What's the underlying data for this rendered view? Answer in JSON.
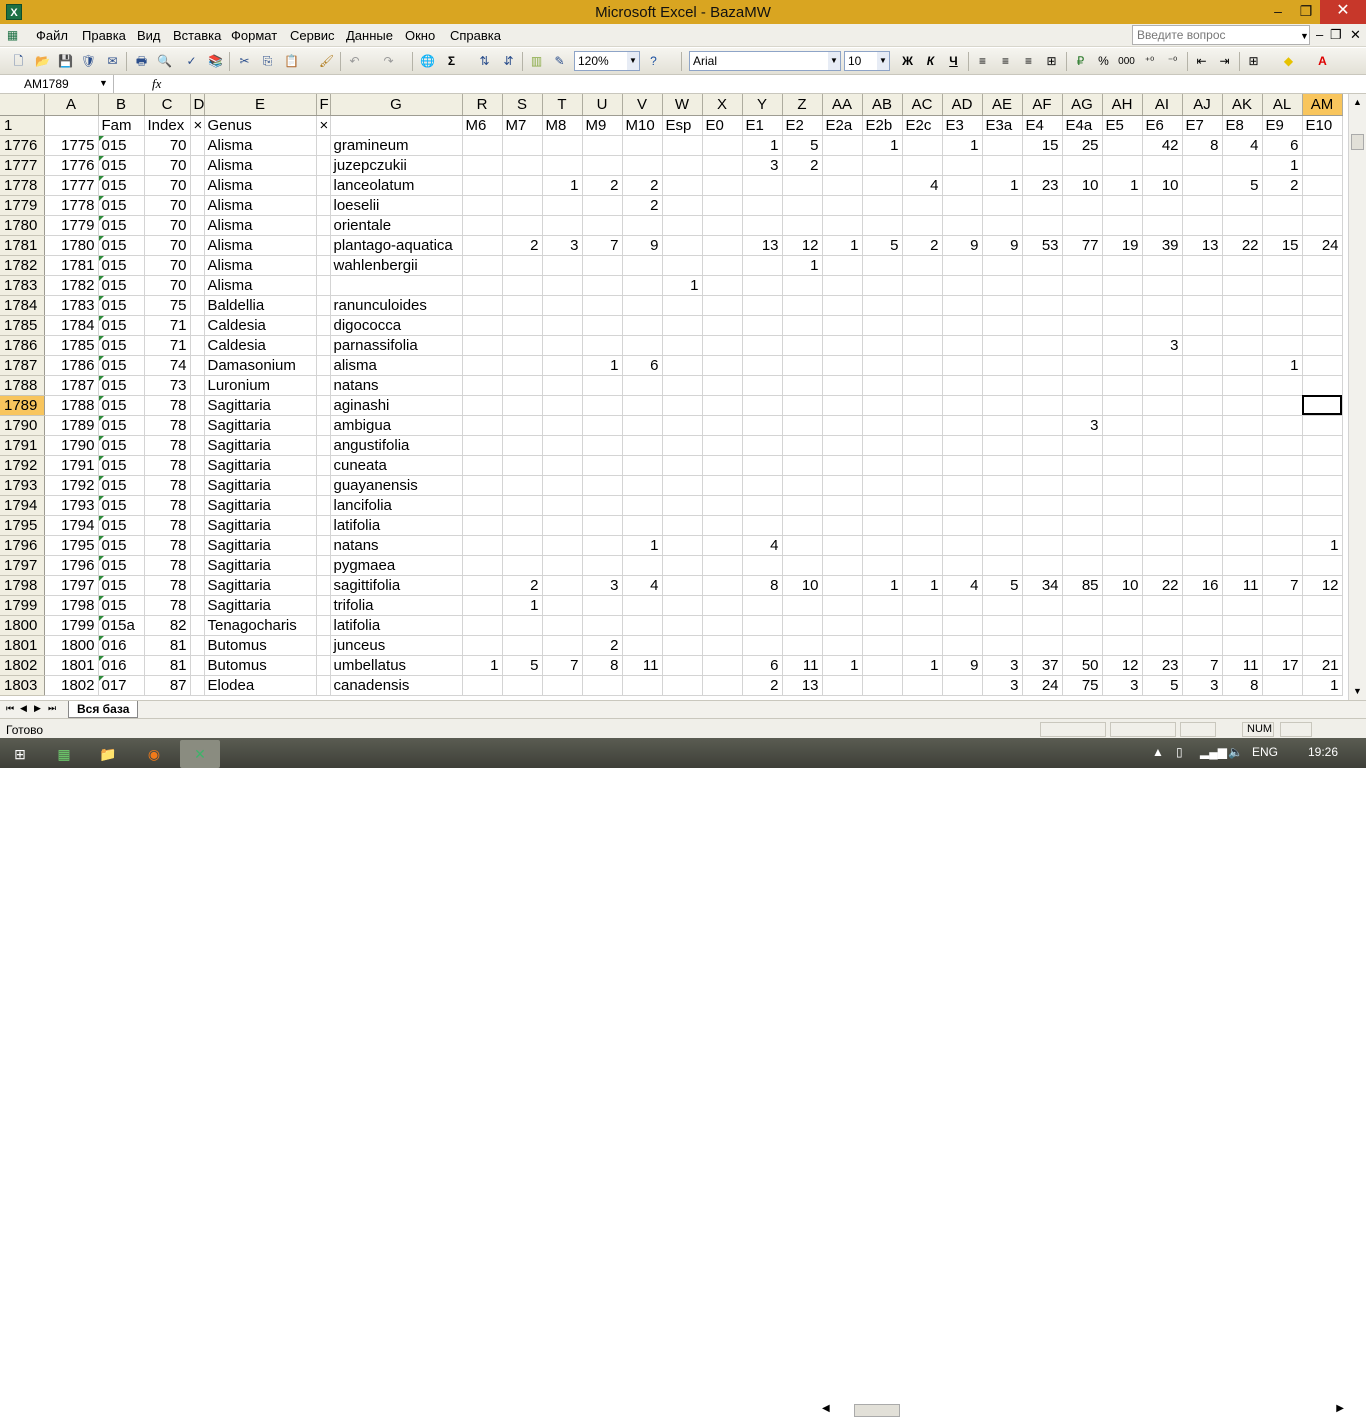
{
  "window": {
    "title": "Microsoft Excel - BazaMW",
    "app_icon": "X"
  },
  "menu": [
    "Файл",
    "Правка",
    "Вид",
    "Вставка",
    "Формат",
    "Сервис",
    "Данные",
    "Окно",
    "Справка"
  ],
  "help_box": {
    "placeholder": "Введите вопрос"
  },
  "toolbar": {
    "zoom": "120%",
    "font": "Arial",
    "size": "10",
    "bold": "Ж",
    "italic": "К",
    "underline": "Ч",
    "percent": "%",
    "thousands": "000",
    "sigma": "Σ"
  },
  "formula_bar": {
    "name_box": "AM1789",
    "fx": "fx",
    "value": ""
  },
  "columns": [
    "A",
    "B",
    "C",
    "D",
    "E",
    "F",
    "G",
    "R",
    "S",
    "T",
    "U",
    "V",
    "W",
    "X",
    "Y",
    "Z",
    "AA",
    "AB",
    "AC",
    "AD",
    "AE",
    "AF",
    "AG",
    "AH",
    "AI",
    "AJ",
    "AK",
    "AL",
    "AM"
  ],
  "header_row": {
    "row_number": "1",
    "cells": [
      "",
      "Fam",
      "Index",
      "×",
      "Genus",
      "×",
      "",
      "M6",
      "M7",
      "M8",
      "M9",
      "M10",
      "Esp",
      "E0",
      "E1",
      "E2",
      "E2a",
      "E2b",
      "E2c",
      "E3",
      "E3a",
      "E4",
      "E4a",
      "E5",
      "E6",
      "E7",
      "E8",
      "E9",
      "E10"
    ]
  },
  "rows": [
    {
      "n": "1776",
      "c": [
        "1775",
        "015",
        "70",
        "",
        "Alisma",
        "",
        "gramineum",
        "",
        "",
        "",
        "",
        "",
        "",
        "",
        "1",
        "5",
        "",
        "1",
        "",
        "1",
        "",
        "15",
        "25",
        "",
        "42",
        "8",
        "4",
        "6",
        ""
      ]
    },
    {
      "n": "1777",
      "c": [
        "1776",
        "015",
        "70",
        "",
        "Alisma",
        "",
        "juzepczukii",
        "",
        "",
        "",
        "",
        "",
        "",
        "",
        "3",
        "2",
        "",
        "",
        "",
        "",
        "",
        "",
        "",
        "",
        "",
        "",
        "",
        "1",
        ""
      ]
    },
    {
      "n": "1778",
      "c": [
        "1777",
        "015",
        "70",
        "",
        "Alisma",
        "",
        "lanceolatum",
        "",
        "",
        "1",
        "2",
        "2",
        "",
        "",
        "",
        "",
        "",
        "",
        "4",
        "",
        "1",
        "23",
        "10",
        "1",
        "10",
        "",
        "5",
        "2",
        ""
      ]
    },
    {
      "n": "1779",
      "c": [
        "1778",
        "015",
        "70",
        "",
        "Alisma",
        "",
        "loeselii",
        "",
        "",
        "",
        "",
        "2",
        "",
        "",
        "",
        "",
        "",
        "",
        "",
        "",
        "",
        "",
        "",
        "",
        "",
        "",
        "",
        "",
        ""
      ]
    },
    {
      "n": "1780",
      "c": [
        "1779",
        "015",
        "70",
        "",
        "Alisma",
        "",
        "orientale",
        "",
        "",
        "",
        "",
        "",
        "",
        "",
        "",
        "",
        "",
        "",
        "",
        "",
        "",
        "",
        "",
        "",
        "",
        "",
        "",
        "",
        ""
      ]
    },
    {
      "n": "1781",
      "c": [
        "1780",
        "015",
        "70",
        "",
        "Alisma",
        "",
        "plantago-aquatica",
        "",
        "2",
        "3",
        "7",
        "9",
        "",
        "",
        "13",
        "12",
        "1",
        "5",
        "2",
        "9",
        "9",
        "53",
        "77",
        "19",
        "39",
        "13",
        "22",
        "15",
        "24"
      ]
    },
    {
      "n": "1782",
      "c": [
        "1781",
        "015",
        "70",
        "",
        "Alisma",
        "",
        "wahlenbergii",
        "",
        "",
        "",
        "",
        "",
        "",
        "",
        "",
        "1",
        "",
        "",
        "",
        "",
        "",
        "",
        "",
        "",
        "",
        "",
        "",
        "",
        ""
      ]
    },
    {
      "n": "1783",
      "c": [
        "1782",
        "015",
        "70",
        "",
        "Alisma",
        "",
        "",
        "",
        "",
        "",
        "",
        "",
        "1",
        "",
        "",
        "",
        "",
        "",
        "",
        "",
        "",
        "",
        "",
        "",
        "",
        "",
        "",
        "",
        ""
      ]
    },
    {
      "n": "1784",
      "c": [
        "1783",
        "015",
        "75",
        "",
        "Baldellia",
        "",
        "ranunculoides",
        "",
        "",
        "",
        "",
        "",
        "",
        "",
        "",
        "",
        "",
        "",
        "",
        "",
        "",
        "",
        "",
        "",
        "",
        "",
        "",
        "",
        ""
      ]
    },
    {
      "n": "1785",
      "c": [
        "1784",
        "015",
        "71",
        "",
        "Caldesia",
        "",
        "digococca",
        "",
        "",
        "",
        "",
        "",
        "",
        "",
        "",
        "",
        "",
        "",
        "",
        "",
        "",
        "",
        "",
        "",
        "",
        "",
        "",
        "",
        ""
      ]
    },
    {
      "n": "1786",
      "c": [
        "1785",
        "015",
        "71",
        "",
        "Caldesia",
        "",
        "parnassifolia",
        "",
        "",
        "",
        "",
        "",
        "",
        "",
        "",
        "",
        "",
        "",
        "",
        "",
        "",
        "",
        "",
        "",
        "3",
        "",
        "",
        "",
        ""
      ]
    },
    {
      "n": "1787",
      "c": [
        "1786",
        "015",
        "74",
        "",
        "Damasonium",
        "",
        "alisma",
        "",
        "",
        "",
        "1",
        "6",
        "",
        "",
        "",
        "",
        "",
        "",
        "",
        "",
        "",
        "",
        "",
        "",
        "",
        "",
        "",
        "1",
        ""
      ]
    },
    {
      "n": "1788",
      "c": [
        "1787",
        "015",
        "73",
        "",
        "Luronium",
        "",
        "natans",
        "",
        "",
        "",
        "",
        "",
        "",
        "",
        "",
        "",
        "",
        "",
        "",
        "",
        "",
        "",
        "",
        "",
        "",
        "",
        "",
        "",
        ""
      ]
    },
    {
      "n": "1789",
      "c": [
        "1788",
        "015",
        "78",
        "",
        "Sagittaria",
        "",
        "aginashi",
        "",
        "",
        "",
        "",
        "",
        "",
        "",
        "",
        "",
        "",
        "",
        "",
        "",
        "",
        "",
        "",
        "",
        "",
        "",
        "",
        "",
        ""
      ]
    },
    {
      "n": "1790",
      "c": [
        "1789",
        "015",
        "78",
        "",
        "Sagittaria",
        "",
        "ambigua",
        "",
        "",
        "",
        "",
        "",
        "",
        "",
        "",
        "",
        "",
        "",
        "",
        "",
        "",
        "",
        "3",
        "",
        "",
        "",
        "",
        "",
        ""
      ]
    },
    {
      "n": "1791",
      "c": [
        "1790",
        "015",
        "78",
        "",
        "Sagittaria",
        "",
        "angustifolia",
        "",
        "",
        "",
        "",
        "",
        "",
        "",
        "",
        "",
        "",
        "",
        "",
        "",
        "",
        "",
        "",
        "",
        "",
        "",
        "",
        "",
        ""
      ]
    },
    {
      "n": "1792",
      "c": [
        "1791",
        "015",
        "78",
        "",
        "Sagittaria",
        "",
        "cuneata",
        "",
        "",
        "",
        "",
        "",
        "",
        "",
        "",
        "",
        "",
        "",
        "",
        "",
        "",
        "",
        "",
        "",
        "",
        "",
        "",
        "",
        ""
      ]
    },
    {
      "n": "1793",
      "c": [
        "1792",
        "015",
        "78",
        "",
        "Sagittaria",
        "",
        "guayanensis",
        "",
        "",
        "",
        "",
        "",
        "",
        "",
        "",
        "",
        "",
        "",
        "",
        "",
        "",
        "",
        "",
        "",
        "",
        "",
        "",
        "",
        ""
      ]
    },
    {
      "n": "1794",
      "c": [
        "1793",
        "015",
        "78",
        "",
        "Sagittaria",
        "",
        "lancifolia",
        "",
        "",
        "",
        "",
        "",
        "",
        "",
        "",
        "",
        "",
        "",
        "",
        "",
        "",
        "",
        "",
        "",
        "",
        "",
        "",
        "",
        ""
      ]
    },
    {
      "n": "1795",
      "c": [
        "1794",
        "015",
        "78",
        "",
        "Sagittaria",
        "",
        "latifolia",
        "",
        "",
        "",
        "",
        "",
        "",
        "",
        "",
        "",
        "",
        "",
        "",
        "",
        "",
        "",
        "",
        "",
        "",
        "",
        "",
        "",
        ""
      ]
    },
    {
      "n": "1796",
      "c": [
        "1795",
        "015",
        "78",
        "",
        "Sagittaria",
        "",
        "natans",
        "",
        "",
        "",
        "",
        "1",
        "",
        "",
        "4",
        "",
        "",
        "",
        "",
        "",
        "",
        "",
        "",
        "",
        "",
        "",
        "",
        "",
        "1"
      ]
    },
    {
      "n": "1797",
      "c": [
        "1796",
        "015",
        "78",
        "",
        "Sagittaria",
        "",
        "pygmaea",
        "",
        "",
        "",
        "",
        "",
        "",
        "",
        "",
        "",
        "",
        "",
        "",
        "",
        "",
        "",
        "",
        "",
        "",
        "",
        "",
        "",
        ""
      ]
    },
    {
      "n": "1798",
      "c": [
        "1797",
        "015",
        "78",
        "",
        "Sagittaria",
        "",
        "sagittifolia",
        "",
        "2",
        "",
        "3",
        "4",
        "",
        "",
        "8",
        "10",
        "",
        "1",
        "1",
        "4",
        "5",
        "34",
        "85",
        "10",
        "22",
        "16",
        "11",
        "7",
        "12"
      ]
    },
    {
      "n": "1799",
      "c": [
        "1798",
        "015",
        "78",
        "",
        "Sagittaria",
        "",
        "trifolia",
        "",
        "1",
        "",
        "",
        "",
        "",
        "",
        "",
        "",
        "",
        "",
        "",
        "",
        "",
        "",
        "",
        "",
        "",
        "",
        "",
        "",
        ""
      ]
    },
    {
      "n": "1800",
      "c": [
        "1799",
        "015a",
        "82",
        "",
        "Tenagocharis",
        "",
        "latifolia",
        "",
        "",
        "",
        "",
        "",
        "",
        "",
        "",
        "",
        "",
        "",
        "",
        "",
        "",
        "",
        "",
        "",
        "",
        "",
        "",
        "",
        ""
      ]
    },
    {
      "n": "1801",
      "c": [
        "1800",
        "016",
        "81",
        "",
        "Butomus",
        "",
        "junceus",
        "",
        "",
        "",
        "2",
        "",
        "",
        "",
        "",
        "",
        "",
        "",
        "",
        "",
        "",
        "",
        "",
        "",
        "",
        "",
        "",
        "",
        ""
      ]
    },
    {
      "n": "1802",
      "c": [
        "1801",
        "016",
        "81",
        "",
        "Butomus",
        "",
        "umbellatus",
        "1",
        "5",
        "7",
        "8",
        "11",
        "",
        "",
        "6",
        "11",
        "1",
        "",
        "1",
        "9",
        "3",
        "37",
        "50",
        "12",
        "23",
        "7",
        "11",
        "17",
        "21"
      ]
    },
    {
      "n": "1803",
      "c": [
        "1802",
        "017",
        "87",
        "",
        "Elodea",
        "",
        "canadensis",
        "",
        "",
        "",
        "",
        "",
        "",
        "",
        "2",
        "13",
        "",
        "",
        "",
        "",
        "3",
        "24",
        "75",
        "3",
        "5",
        "3",
        "8",
        "",
        "1"
      ]
    }
  ],
  "sheet_tab": "Вся база",
  "status": {
    "text": "Готово",
    "num": "NUM"
  },
  "taskbar": {
    "lang": "ENG",
    "time": "19:26"
  }
}
